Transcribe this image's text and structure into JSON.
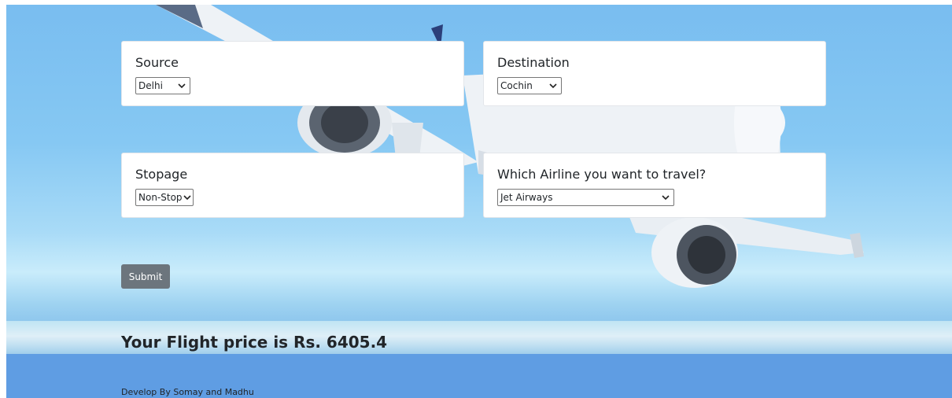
{
  "form": {
    "source": {
      "label": "Source",
      "selected": "Delhi"
    },
    "destination": {
      "label": "Destination",
      "selected": "Cochin"
    },
    "stopage": {
      "label": "Stopage",
      "selected": "Non-Stop"
    },
    "airline": {
      "label": "Which Airline you want to travel?",
      "selected": "Jet Airways"
    },
    "submit_label": "Submit"
  },
  "result": {
    "text": "Your Flight price is Rs. 6405.4"
  },
  "footer": {
    "text": "Develop By Somay and Madhu"
  },
  "icons": {
    "dropdown": "chevron-down-icon",
    "background": "airplane-background"
  },
  "colors": {
    "sky": "#79bdf0",
    "sea": "#5f9de3",
    "button": "#6c757d",
    "card": "#ffffff"
  }
}
